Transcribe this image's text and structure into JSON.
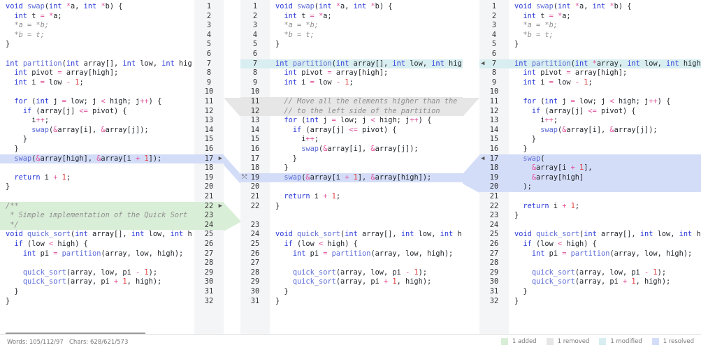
{
  "panes": {
    "left": {
      "lines": [
        "void swap(int *a, int *b) {",
        "  int t = *a;",
        "  *a = *b;",
        "  *b = t;",
        "}",
        "",
        "int partition(int array[], int low, int hig",
        "  int pivot = array[high];",
        "  int i = low - 1;",
        "",
        "  for (int j = low; j < high; j++) {",
        "    if (array[j] <= pivot) {",
        "      i++;",
        "      swap(&array[i], &array[j]);",
        "    }",
        "  }",
        "  swap(&array[high], &array[i + 1]);",
        "",
        "  return i + 1;",
        "}",
        "",
        "/**",
        " * Simple implementation of the Quick Sort",
        " */",
        "void quick_sort(int array[], int low, int h",
        "  if (low < high) {",
        "    int pi = partition(array, low, high);",
        "",
        "    quick_sort(array, low, pi - 1);",
        "    quick_sort(array, pi + 1, high);",
        "  }",
        "}"
      ]
    },
    "middle": {
      "lines": [
        "void swap(int *a, int *b) {",
        "  int t = *a;",
        "  *a = *b;",
        "  *b = t;",
        "}",
        "",
        "int partition(int array[], int low, int hig",
        "  int pivot = array[high];",
        "  int i = low - 1;",
        "",
        "  // Move all the elements higher than the",
        "  // to the left side of the partition",
        "  for (int j = low; j < high; j++) {",
        "    if (array[j] <= pivot) {",
        "      i++;",
        "      swap(&array[i], &array[j]);",
        "    }",
        "  }",
        "  swap(&array[i + 1], &array[high]);",
        "",
        "  return i + 1;",
        "}",
        "",
        "void quick_sort(int array[], int low, int h",
        "  if (low < high) {",
        "    int pi = partition(array, low, high);",
        "",
        "    quick_sort(array, low, pi - 1);",
        "    quick_sort(array, pi + 1, high);",
        "  }",
        "}"
      ]
    },
    "right": {
      "lines": [
        "void swap(int *a, int *b) {",
        "  int t = *a;",
        "  *a = *b;",
        "  *b = t;",
        "}",
        "",
        "int partition(int *array, int low, int high",
        "  int pivot = array[high];",
        "  int i = low - 1;",
        "",
        "  for (int j = low; j < high; j++) {",
        "    if (array[j] <= pivot) {",
        "      i++;",
        "      swap(&array[i], &array[j]);",
        "    }",
        "  }",
        "  swap(",
        "    &array[i + 1],",
        "    &array[high]",
        "  );",
        "",
        "  return i + 1;",
        "}",
        "",
        "void quick_sort(int array[], int low, int h",
        "  if (low < high) {",
        "    int pi = partition(array, low, high);",
        "",
        "    quick_sort(array, low, pi - 1);",
        "    quick_sort(array, pi + 1, high);",
        "  }",
        "}"
      ]
    }
  },
  "gutters": {
    "left_numbers": [
      "1",
      "2",
      "3",
      "4",
      "5",
      "6",
      "7",
      "8",
      "9",
      "10",
      "11",
      "12",
      "13",
      "14",
      "15",
      "16",
      "17",
      "18",
      "19",
      "20",
      "21",
      "22",
      "23",
      "24",
      "25",
      "26",
      "27",
      "28",
      "29",
      "30",
      "31",
      "32"
    ],
    "middle_numbers": [
      "1",
      "2",
      "3",
      "4",
      "5",
      "6",
      "7",
      "8",
      "9",
      "10",
      "11",
      "12",
      "13",
      "14",
      "15",
      "16",
      "17",
      "18",
      "19",
      "20",
      "21",
      "22",
      "23",
      "24",
      "25",
      "26",
      "27",
      "28",
      "29",
      "30",
      "31"
    ],
    "right_numbers": [
      "1",
      "2",
      "3",
      "4",
      "5",
      "6",
      "7",
      "8",
      "9",
      "10",
      "11",
      "12",
      "13",
      "14",
      "15",
      "16",
      "17",
      "18",
      "19",
      "20",
      "21",
      "22",
      "23",
      "24",
      "25",
      "26",
      "27",
      "28",
      "29",
      "30",
      "31",
      "32"
    ]
  },
  "status": {
    "words": "Words: 105/112/97",
    "chars": "Chars: 628/621/573"
  },
  "legend": [
    {
      "label": "1 added",
      "color": "#d9eed7"
    },
    {
      "label": "1 removed",
      "color": "#e6e6e6"
    },
    {
      "label": "1 modified",
      "color": "#d9eef0"
    },
    {
      "label": "1 resolved",
      "color": "#d4ddf8"
    }
  ],
  "icons": {
    "left_arrow": "▶",
    "right_arrow": "◀",
    "resolve": "⤲"
  }
}
